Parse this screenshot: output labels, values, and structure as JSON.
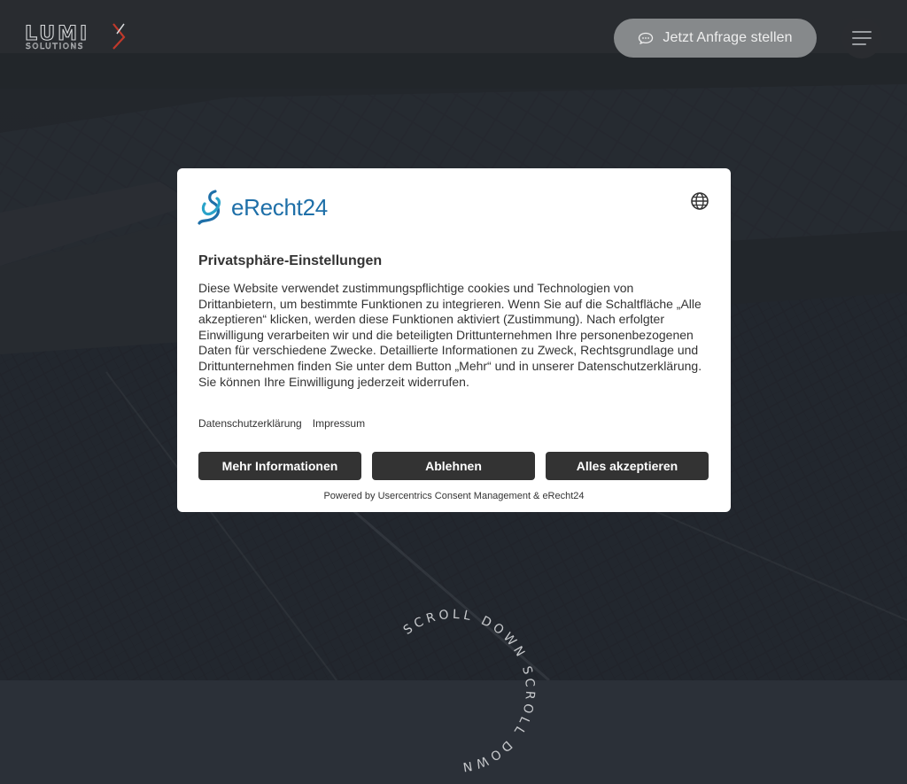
{
  "header": {
    "logo_main": "LUMI",
    "logo_sub": "SOLUTIONS",
    "cta_label": "Jetzt Anfrage stellen",
    "cta_icon": "chat-icon",
    "menu_icon": "hamburger-icon"
  },
  "hero": {
    "scroll_text": "SCROLL DOWN SCROLL DOWN "
  },
  "consent": {
    "brand": "eRecht24",
    "language_icon": "globe-icon",
    "title": "Privatsphäre-Einstellungen",
    "body": "Diese Website verwendet zustimmungspflichtige cookies und Technologien von Drittanbietern, um bestimmte Funktionen zu integrieren. Wenn Sie auf die Schaltfläche „Alle akzeptieren“ klicken, werden diese Funktionen aktiviert (Zustimmung). Nach erfolgter Einwilligung verarbeiten wir und die beteiligten Drittunternehmen Ihre personenbezogenen Daten für verschiedene Zwecke. Detaillierte Informationen zu Zweck, Rechtsgrundlage und Drittunternehmen finden Sie unter dem Button „Mehr“ und in unserer Datenschutzerklärung. Sie können Ihre Einwilligung jederzeit widerrufen.",
    "links": {
      "privacy": "Datenschutzerklärung",
      "imprint": "Impressum"
    },
    "buttons": {
      "more": "Mehr Informationen",
      "decline": "Ablehnen",
      "accept": "Alles akzeptieren"
    },
    "powered_by": "Powered by Usercentrics Consent Management & eRecht24"
  },
  "colors": {
    "dialog_bg": "#ffffff",
    "button_bg": "#333333",
    "brand_blue": "#1e6fa8",
    "brand_teal": "#2aa3c9",
    "logo_accent": "#c0392b"
  }
}
